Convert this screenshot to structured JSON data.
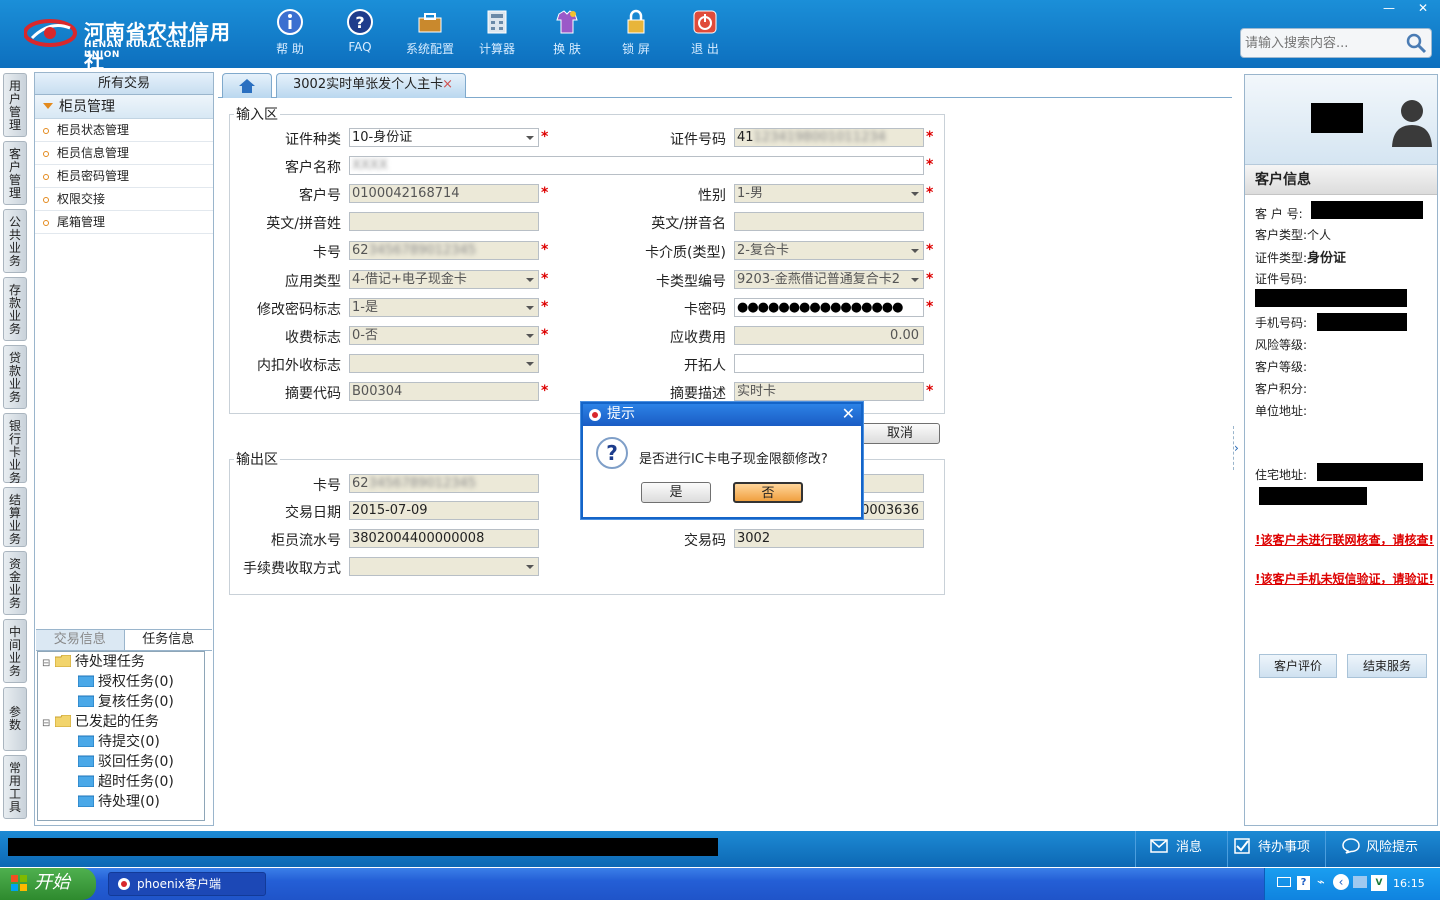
{
  "header": {
    "logo_cn": "河南省农村信用社",
    "logo_en": "HENAN RURAL CREDIT UNION",
    "toolbar": [
      {
        "label": "帮 助",
        "icon": "info-icon"
      },
      {
        "label": "FAQ",
        "icon": "help-icon"
      },
      {
        "label": "系统配置",
        "icon": "toolbox-icon"
      },
      {
        "label": "计算器",
        "icon": "calculator-icon"
      },
      {
        "label": "换 肤",
        "icon": "skin-icon"
      },
      {
        "label": "锁 屏",
        "icon": "lock-icon"
      },
      {
        "label": "退 出",
        "icon": "power-icon"
      }
    ],
    "search_placeholder": "请输入搜索内容..."
  },
  "vtabs": [
    "用户管理",
    "客户管理",
    "公共业务",
    "存款业务",
    "贷款业务",
    "银行卡业务",
    "结算业务",
    "资金业务",
    "中间业务",
    "参数",
    "常用工具"
  ],
  "left": {
    "title": "所有交易",
    "group": "柜员管理",
    "items": [
      "柜员状态管理",
      "柜员信息管理",
      "柜员密码管理",
      "权限交接",
      "尾箱管理"
    ],
    "tabs": [
      "交易信息",
      "任务信息"
    ],
    "tree": {
      "pending": "待处理任务",
      "pending_items": [
        "授权任务(0)",
        "复核任务(0)"
      ],
      "initiated": "已发起的任务",
      "initiated_items": [
        "待提交(0)",
        "驳回任务(0)",
        "超时任务(0)",
        "待处理(0)"
      ]
    }
  },
  "tab": {
    "label": "3002实时单张发个人主卡",
    "close": "×"
  },
  "input": {
    "legend": "输入区",
    "labels": {
      "id_type": "证件种类",
      "id_no": "证件号码",
      "cust_name": "客户名称",
      "cust_no": "客户号",
      "gender": "性别",
      "en_last": "英文/拼音姓",
      "en_first": "英文/拼音名",
      "card_no": "卡号",
      "card_medium": "卡介质(类型)",
      "app_type": "应用类型",
      "card_type_no": "卡类型编号",
      "pwd_flag": "修改密码标志",
      "card_pwd": "卡密码",
      "fee_flag": "收费标志",
      "fee_due": "应收费用",
      "inner_outer": "内扣外收标志",
      "developer": "开拓人",
      "summary_code": "摘要代码",
      "summary_desc": "摘要描述"
    },
    "values": {
      "id_type": "10-身份证",
      "id_no": "41",
      "cust_name": "",
      "cust_no": "0100042168714",
      "gender": "1-男",
      "card_no": "62",
      "card_medium": "2-复合卡",
      "app_type": "4-借记+电子现金卡",
      "card_type_no": "9203-金燕借记普通复合卡2",
      "pwd_flag": "1-是",
      "card_pwd": "●●●●●●●●●●●●●●●●",
      "fee_flag": "0-否",
      "fee_due": "0.00",
      "summary_code": "B00304",
      "summary_desc": "实时卡"
    },
    "required": "*"
  },
  "cancel": "取消",
  "output": {
    "legend": "输出区",
    "labels": {
      "card_no": "卡号",
      "trade_date": "交易日期",
      "teller_serial": "柜员流水号",
      "trade_code": "交易码",
      "fee_mode": "手续费收取方式"
    },
    "values": {
      "card_no": "62",
      "trade_date": "2015-07-09",
      "hidden_serial": "0003636",
      "teller_serial": "3802004400000008",
      "trade_code": "3002"
    }
  },
  "dialog": {
    "title": "提示",
    "message": "是否进行IC卡电子现金限额修改?",
    "yes": "是",
    "no": "否"
  },
  "right": {
    "title": "客户信息",
    "fields": {
      "cust_no": "客 户 号:",
      "cust_type": "客户类型:",
      "cust_type_val": "个人",
      "id_type": "证件类型:",
      "id_type_val": "身份证",
      "id_no": "证件号码:",
      "phone": "手机号码:",
      "risk": "风险等级:",
      "level": "客户等级:",
      "points": "客户积分:",
      "unit_addr": "单位地址:",
      "home_addr": "住宅地址:"
    },
    "warn1": "!该客户未进行联网核查，请核查!",
    "warn2": "!该客户手机未短信验证，请验证!",
    "btn_eval": "客户评价",
    "btn_end": "结束服务"
  },
  "status": {
    "msg": "消息",
    "todo": "待办事项",
    "risk": "风险提示"
  },
  "taskbar": {
    "start": "开始",
    "app": "phoenix客户端",
    "time": "16:15"
  }
}
